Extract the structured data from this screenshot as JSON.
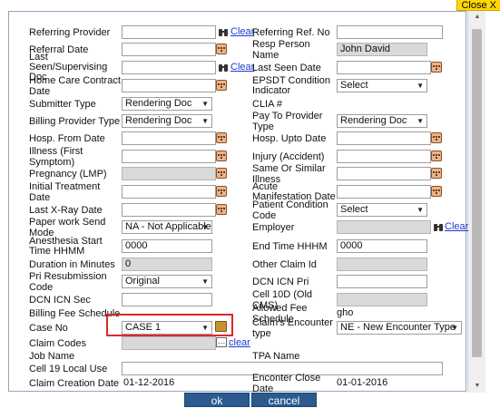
{
  "close_label": "Close X",
  "rows": {
    "r1": {
      "left_label": "Referring Provider",
      "left_link": "Clear",
      "right_label": "Referring Ref. No",
      "right_value": ""
    },
    "r2": {
      "left_label": "Referral Date",
      "right_label": "Resp Person Name",
      "right_value": "John David"
    },
    "r3": {
      "left_label": "Last Seen/Supervising Doc",
      "left_link": "Clear",
      "right_label": "Last Seen Date"
    },
    "r4": {
      "left_label": "Home Care Contract Date",
      "right_label": "EPSDT Condition Indicator",
      "right_select": "Select"
    },
    "r5": {
      "left_label": "Submitter Type",
      "left_select": "Rendering Doc",
      "right_label": "CLIA #"
    },
    "r6": {
      "left_label": "Billing Provider Type",
      "left_select": "Rendering Doc",
      "right_label": "Pay To Provider Type",
      "right_select": "Rendering Doc"
    },
    "r7": {
      "left_label": "Hosp. From Date",
      "right_label": "Hosp. Upto Date"
    },
    "r8": {
      "left_label": "Illness (First Symptom)",
      "right_label": "Injury (Accident)"
    },
    "r9": {
      "left_label": "Pregnancy (LMP)",
      "right_label": "Same Or Similar Illness"
    },
    "r10": {
      "left_label": "Initial Treatment Date",
      "right_label": "Acute Manifestation Date"
    },
    "r11": {
      "left_label": "Last X-Ray Date",
      "right_label": "Patient Condition Code",
      "right_select": "Select"
    },
    "r12": {
      "left_label": "Paper work Send Mode",
      "left_select": "NA - Not Applicable",
      "right_label": "Employer",
      "right_link": "Clear"
    },
    "r13": {
      "left_label": "Anesthesia Start Time HHMM",
      "left_value": "0000",
      "right_label": "End Time HHHM",
      "right_value": "0000"
    },
    "r14": {
      "left_label": "Duration in Minutes",
      "left_value": "0",
      "right_label": "Other Claim Id"
    },
    "r15": {
      "left_label": "Pri Resubmission Code",
      "left_select": "Original",
      "right_label": "DCN ICN Pri"
    },
    "r16": {
      "left_label": "DCN ICN Sec",
      "right_label": "Cell 10D (Old CMS)"
    },
    "r17": {
      "left_label": "Billing Fee Schedule",
      "right_label": "Allowed Fee Schedule",
      "right_value": "gho"
    },
    "r18": {
      "left_label": "Case No",
      "left_select": "CASE 1",
      "right_label": "Claim's Encounter type",
      "right_select": "NE - New Encounter Type"
    },
    "r19": {
      "left_label": "Claim Codes",
      "left_link": "clear"
    },
    "r20": {
      "left_label": "Job Name",
      "right_label": "TPA Name"
    },
    "r21": {
      "left_label": "Cell 19 Local Use"
    },
    "r22": {
      "left_label": "Claim Creation Date",
      "left_value": "01-12-2016",
      "right_label": "Enconter Close Date",
      "right_value": "01-01-2016"
    }
  },
  "buttons": {
    "ok": "ok",
    "cancel": "cancel"
  },
  "colors": {
    "button_bg": "#2b5a8e",
    "highlight": "#e0262d",
    "close_bg": "#ffd800",
    "link": "#1a3ccf"
  },
  "icons": {
    "calendar": "calendar-icon",
    "lookup": "binoculars-icon",
    "folder": "folder-icon",
    "more": "ellipsis-icon"
  }
}
